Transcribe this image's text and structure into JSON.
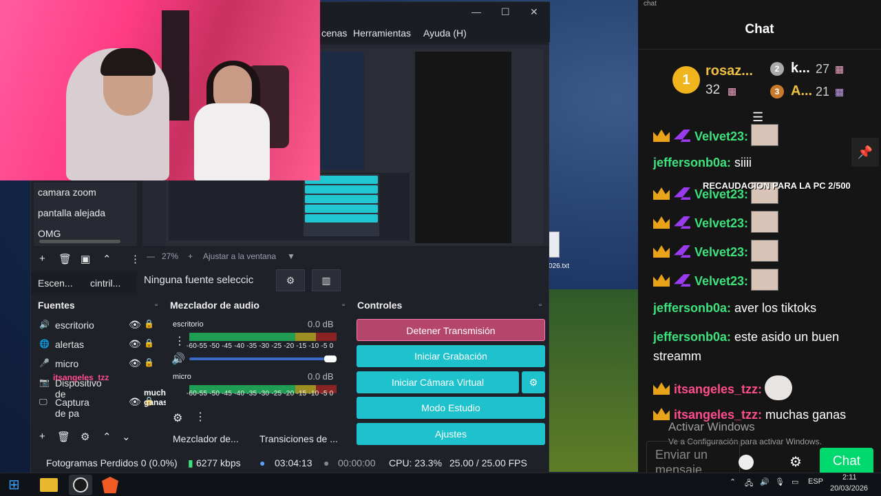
{
  "desktop": {
    "file_label": "026.txt"
  },
  "obs": {
    "menu": {
      "escenas": "cenas",
      "herramientas": "Herramientas",
      "ayuda": "Ayuda (H)"
    },
    "window_controls": {
      "minimize": "—",
      "maximize": "☐",
      "close": "✕"
    },
    "scenes": [
      "camara zoom",
      "pantalla alejada",
      "OMG"
    ],
    "zoom": {
      "level": "27%",
      "fit": "Ajustar a la ventana"
    },
    "dock_tabs": [
      "Escen...",
      "cintril..."
    ],
    "no_source": "Ninguna fuente seleccic",
    "sources": {
      "title": "Fuentes",
      "items": [
        {
          "label": "escritorio",
          "icon": "speaker-icon"
        },
        {
          "label": "alertas",
          "icon": "globe-icon"
        },
        {
          "label": "micro",
          "icon": "mic-icon"
        },
        {
          "label": "Dispositivo de",
          "icon": "camera-icon"
        },
        {
          "label": "Captura de pa",
          "icon": "monitor-icon"
        }
      ]
    },
    "mixer": {
      "title": "Mezclador de audio",
      "channels": [
        {
          "name": "escritorio",
          "db": "0.0 dB",
          "level": 0.88
        },
        {
          "name": "micro",
          "db": "0.0 dB",
          "level": 0.86
        }
      ],
      "scale": "-60-55 -50 -45 -40 -35 -30 -25 -20 -15 -10  -5  0",
      "scale2": "-60-55 -50 -45 -40 -35 -30 -25 -20 -15 -10  -5  0"
    },
    "bottom_tabs": [
      "Mezclador de...",
      "Transiciones de ..."
    ],
    "controls": {
      "title": "Controles",
      "stop_stream": "Detener Transmisión",
      "start_recording": "Iniciar Grabación",
      "start_virtual_cam": "Iniciar Cámara Virtual",
      "studio_mode": "Modo Estudio",
      "settings": "Ajustes"
    },
    "status": {
      "dropped": "Fotogramas Perdidos 0 (0.0%)",
      "bitrate": "6277 kbps",
      "live_time": "03:04:13",
      "rec_time": "00:00:00",
      "cpu": "CPU: 23.3%",
      "fps": "25.00 / 25.00 FPS"
    },
    "overlay_chat": {
      "user": "itsangeles_tzz",
      "msg": "muchas ganas"
    }
  },
  "chat": {
    "window_label": "chat",
    "title": "Chat",
    "leaders": [
      {
        "rank": "1",
        "name": "rosaz...",
        "count": "32"
      },
      {
        "rank": "2",
        "name": "k...",
        "count": "27"
      },
      {
        "rank": "3",
        "name": "A...",
        "count": "21"
      }
    ],
    "goal": "RECAUDACION PARA LA PC 2/500",
    "messages": [
      {
        "user": "Velvet23:",
        "text": "",
        "badges": true,
        "emote": true
      },
      {
        "user": "jeffersonb0a:",
        "text": " siiii",
        "badges": false,
        "emote": false
      },
      {
        "user": "Velvet23:",
        "text": "",
        "badges": true,
        "emote": true
      },
      {
        "user": "Velvet23:",
        "text": "",
        "badges": true,
        "emote": true
      },
      {
        "user": "Velvet23:",
        "text": "",
        "badges": true,
        "emote": true
      },
      {
        "user": "Velvet23:",
        "text": "",
        "badges": true,
        "emote": true
      },
      {
        "user": "jeffersonb0a:",
        "text": " aver los tiktoks",
        "badges": false,
        "emote": false
      },
      {
        "user": "jeffersonb0a:",
        "text": " este asido un buen",
        "badges": false,
        "emote": false
      },
      {
        "user": "",
        "text": "streamm",
        "badges": false,
        "emote": false
      },
      {
        "user": "itsangeles_tzz:",
        "text": "",
        "badges": "crown",
        "emote": "cat"
      },
      {
        "user": "itsangeles_tzz:",
        "text": " muchas ganas",
        "badges": "crown",
        "emote": false
      }
    ],
    "activate_title": "Activar Windows",
    "activate_sub": "Ve a Configuración para activar Windows.",
    "input_placeholder": "Enviar un mensaje",
    "send": "Chat"
  },
  "taskbar": {
    "lang": "ESP",
    "time": "2:11",
    "date": "20/03/2026"
  },
  "colors": {
    "accent": "#1dc2cc",
    "stop": "#b3466a",
    "user_green": "#3ee27c",
    "user_pink": "#ff4d8d",
    "send": "#00d96e"
  }
}
